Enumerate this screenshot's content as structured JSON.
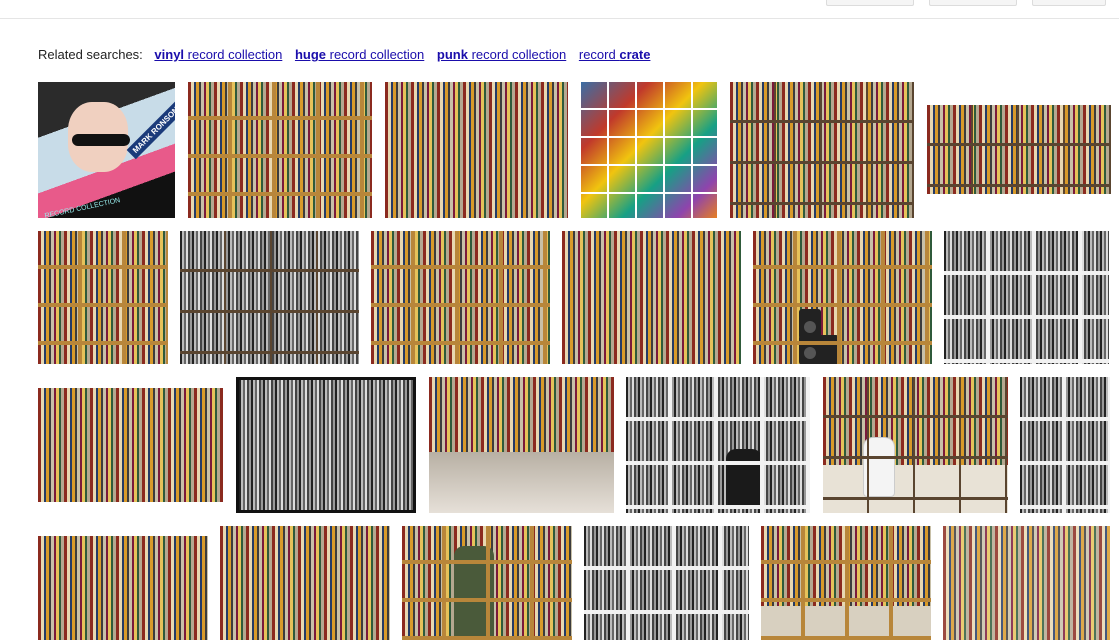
{
  "related_searches": {
    "label": "Related searches:",
    "items": [
      {
        "bold": "vinyl",
        "rest": " record collection"
      },
      {
        "bold": "huge",
        "rest": " record collection"
      },
      {
        "bold": "punk",
        "rest": " record collection"
      },
      {
        "plain": "record ",
        "bold_after": "crate"
      }
    ]
  },
  "album_cover": {
    "title": "MARK RONSON & THE BUSINESS INTL",
    "subtitle": "RECORD COLLECTION"
  }
}
